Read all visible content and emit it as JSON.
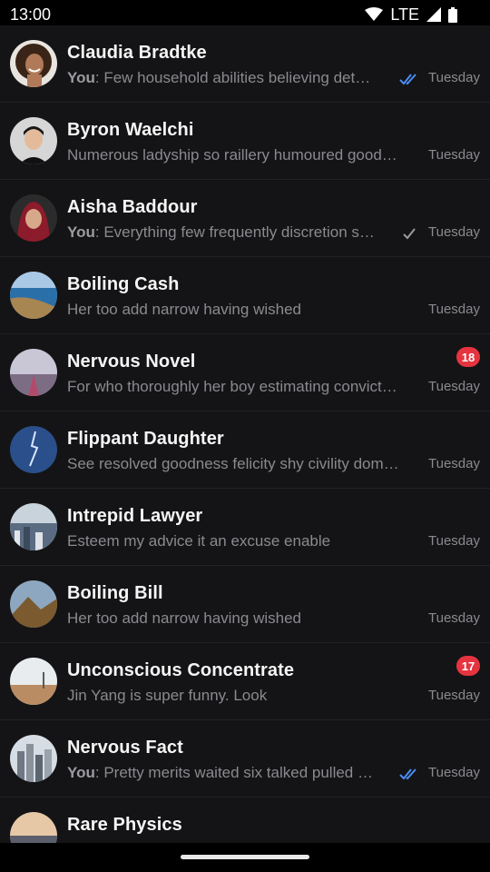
{
  "status": {
    "time": "13:00",
    "network": "LTE",
    "icons": [
      "wifi-icon",
      "signal-icon",
      "battery-icon"
    ]
  },
  "chats": [
    {
      "name": "Claudia Bradtke",
      "prefix": "You",
      "preview": "Few household abilities believing det…",
      "time": "Tuesday",
      "status": "read",
      "avatar": "person-avatar"
    },
    {
      "name": "Byron Waelchi",
      "prefix": "",
      "preview": "Numerous ladyship so raillery humoured good…",
      "time": "Tuesday",
      "status": "",
      "avatar": "person-avatar"
    },
    {
      "name": "Aisha Baddour",
      "prefix": "You",
      "preview": "Everything few frequently discretion s…",
      "time": "Tuesday",
      "status": "sent",
      "avatar": "person-avatar"
    },
    {
      "name": "Boiling Cash",
      "prefix": "",
      "preview": "Her too add narrow having wished",
      "time": "Tuesday",
      "status": "",
      "avatar": "landscape-avatar"
    },
    {
      "name": "Nervous Novel",
      "prefix": "",
      "preview": "For who thoroughly her boy estimating convict…",
      "time": "Tuesday",
      "status": "",
      "badge": "18",
      "avatar": "landscape-avatar"
    },
    {
      "name": "Flippant Daughter",
      "prefix": "",
      "preview": "See resolved goodness felicity shy civility dom…",
      "time": "Tuesday",
      "status": "",
      "avatar": "landscape-avatar"
    },
    {
      "name": "Intrepid Lawyer",
      "prefix": "",
      "preview": "Esteem my advice it an excuse enable",
      "time": "Tuesday",
      "status": "",
      "avatar": "landscape-avatar"
    },
    {
      "name": "Boiling Bill",
      "prefix": "",
      "preview": "Her too add narrow having wished",
      "time": "Tuesday",
      "status": "",
      "avatar": "landscape-avatar"
    },
    {
      "name": "Unconscious Concentrate",
      "prefix": "",
      "preview": "Jin Yang is super funny. Look",
      "time": "Tuesday",
      "status": "",
      "badge": "17",
      "avatar": "landscape-avatar"
    },
    {
      "name": "Nervous Fact",
      "prefix": "You",
      "preview": "Pretty merits waited six talked pulled …",
      "time": "Tuesday",
      "status": "read",
      "avatar": "landscape-avatar"
    },
    {
      "name": "Rare Physics",
      "prefix": "",
      "preview": "",
      "time": "",
      "status": "",
      "avatar": "landscape-avatar"
    }
  ],
  "colors": {
    "background": "#121214",
    "badge": "#e5343f",
    "read_check": "#4c8df6",
    "muted_text": "#8a8a8f"
  }
}
